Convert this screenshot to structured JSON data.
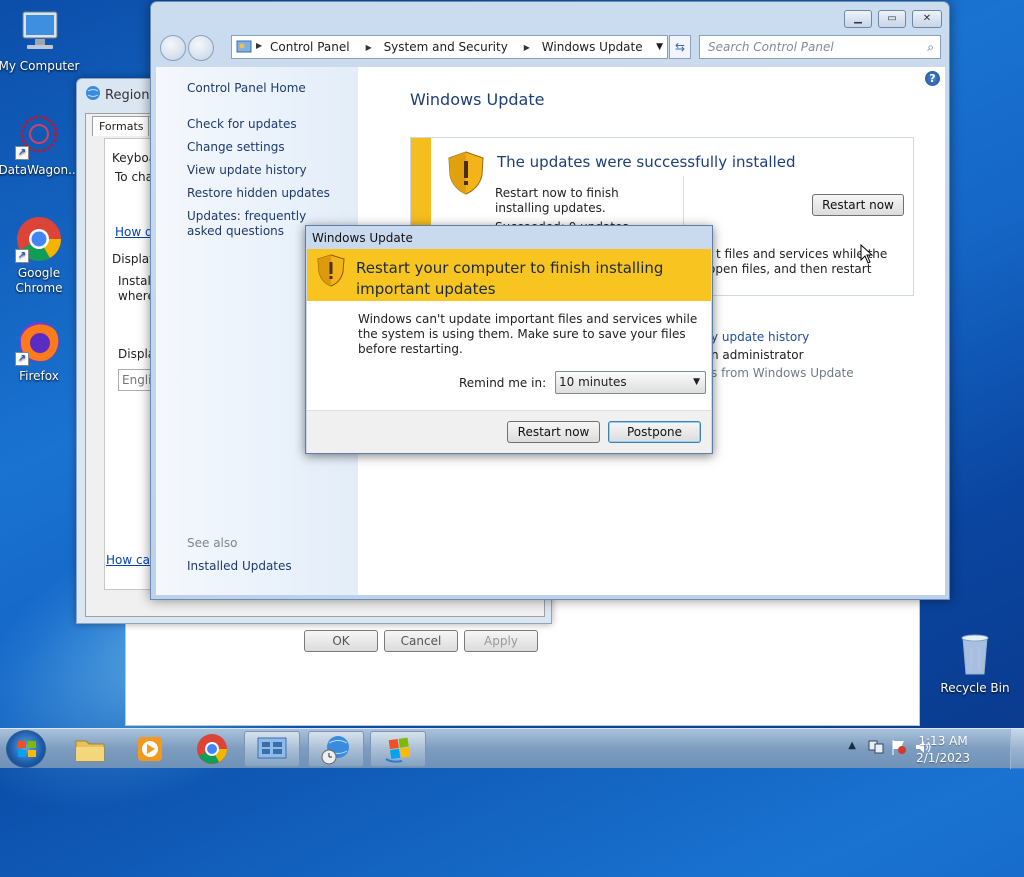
{
  "desktop": {
    "icons": [
      {
        "label": "My Computer",
        "icon": "computer-icon"
      },
      {
        "label": "DataWagon...",
        "icon": "datawagon-icon"
      },
      {
        "label": "Google Chrome",
        "icon": "chrome-icon"
      },
      {
        "label": "Firefox",
        "icon": "firefox-icon"
      },
      {
        "label": "Recycle Bin",
        "icon": "recycle-bin-icon"
      }
    ]
  },
  "region_window": {
    "title": "Region a",
    "tabs": [
      "Formats",
      "L"
    ],
    "keyboard_group": "Keyboa",
    "keyboard_text": "To cha",
    "link1": "How d",
    "display_group": "Display",
    "install_text_1": "Install",
    "install_text_2": "where",
    "display_label": "Displa",
    "display_value": "Englis",
    "link2": "How car",
    "buttons": {
      "ok": "OK",
      "cancel": "Cancel",
      "apply": "Apply"
    }
  },
  "control_panel": {
    "breadcrumb": [
      "Control Panel",
      "System and Security",
      "Windows Update"
    ],
    "search_placeholder": "Search Control Panel",
    "nav": {
      "home": "Control Panel Home",
      "links": [
        "Check for updates",
        "Change settings",
        "View update history",
        "Restore hidden updates",
        "Updates: frequently asked questions"
      ],
      "see_also": "See also",
      "installed_updates": "Installed Updates"
    },
    "main": {
      "heading": "Windows Update",
      "card_title": "The updates were successfully installed",
      "card_text": "Restart now to finish installing updates.",
      "card_succeeded": "Succeeded: 0 updates",
      "restart_now": "Restart now",
      "right_text_1": "t files and services while the",
      "right_text_2": "open files, and then restart",
      "history_link": "y update history",
      "admin_text": "n administrator",
      "from_wu_text": "s from Windows Update"
    }
  },
  "dialog": {
    "title": "Windows Update",
    "heading": "Restart your computer to finish installing important updates",
    "body": "Windows can't update important files and services while the system is using them. Make sure to save your files before restarting.",
    "remind_label": "Remind me in:",
    "remind_value": "10 minutes",
    "restart_now": "Restart now",
    "postpone": "Postpone"
  },
  "taskbar": {
    "time": "1:13 AM",
    "date": "2/1/2023"
  },
  "colors": {
    "accent_yellow": "#f8c41f",
    "title_blue": "#1d3e7a",
    "link_blue": "#1e3a6e"
  }
}
